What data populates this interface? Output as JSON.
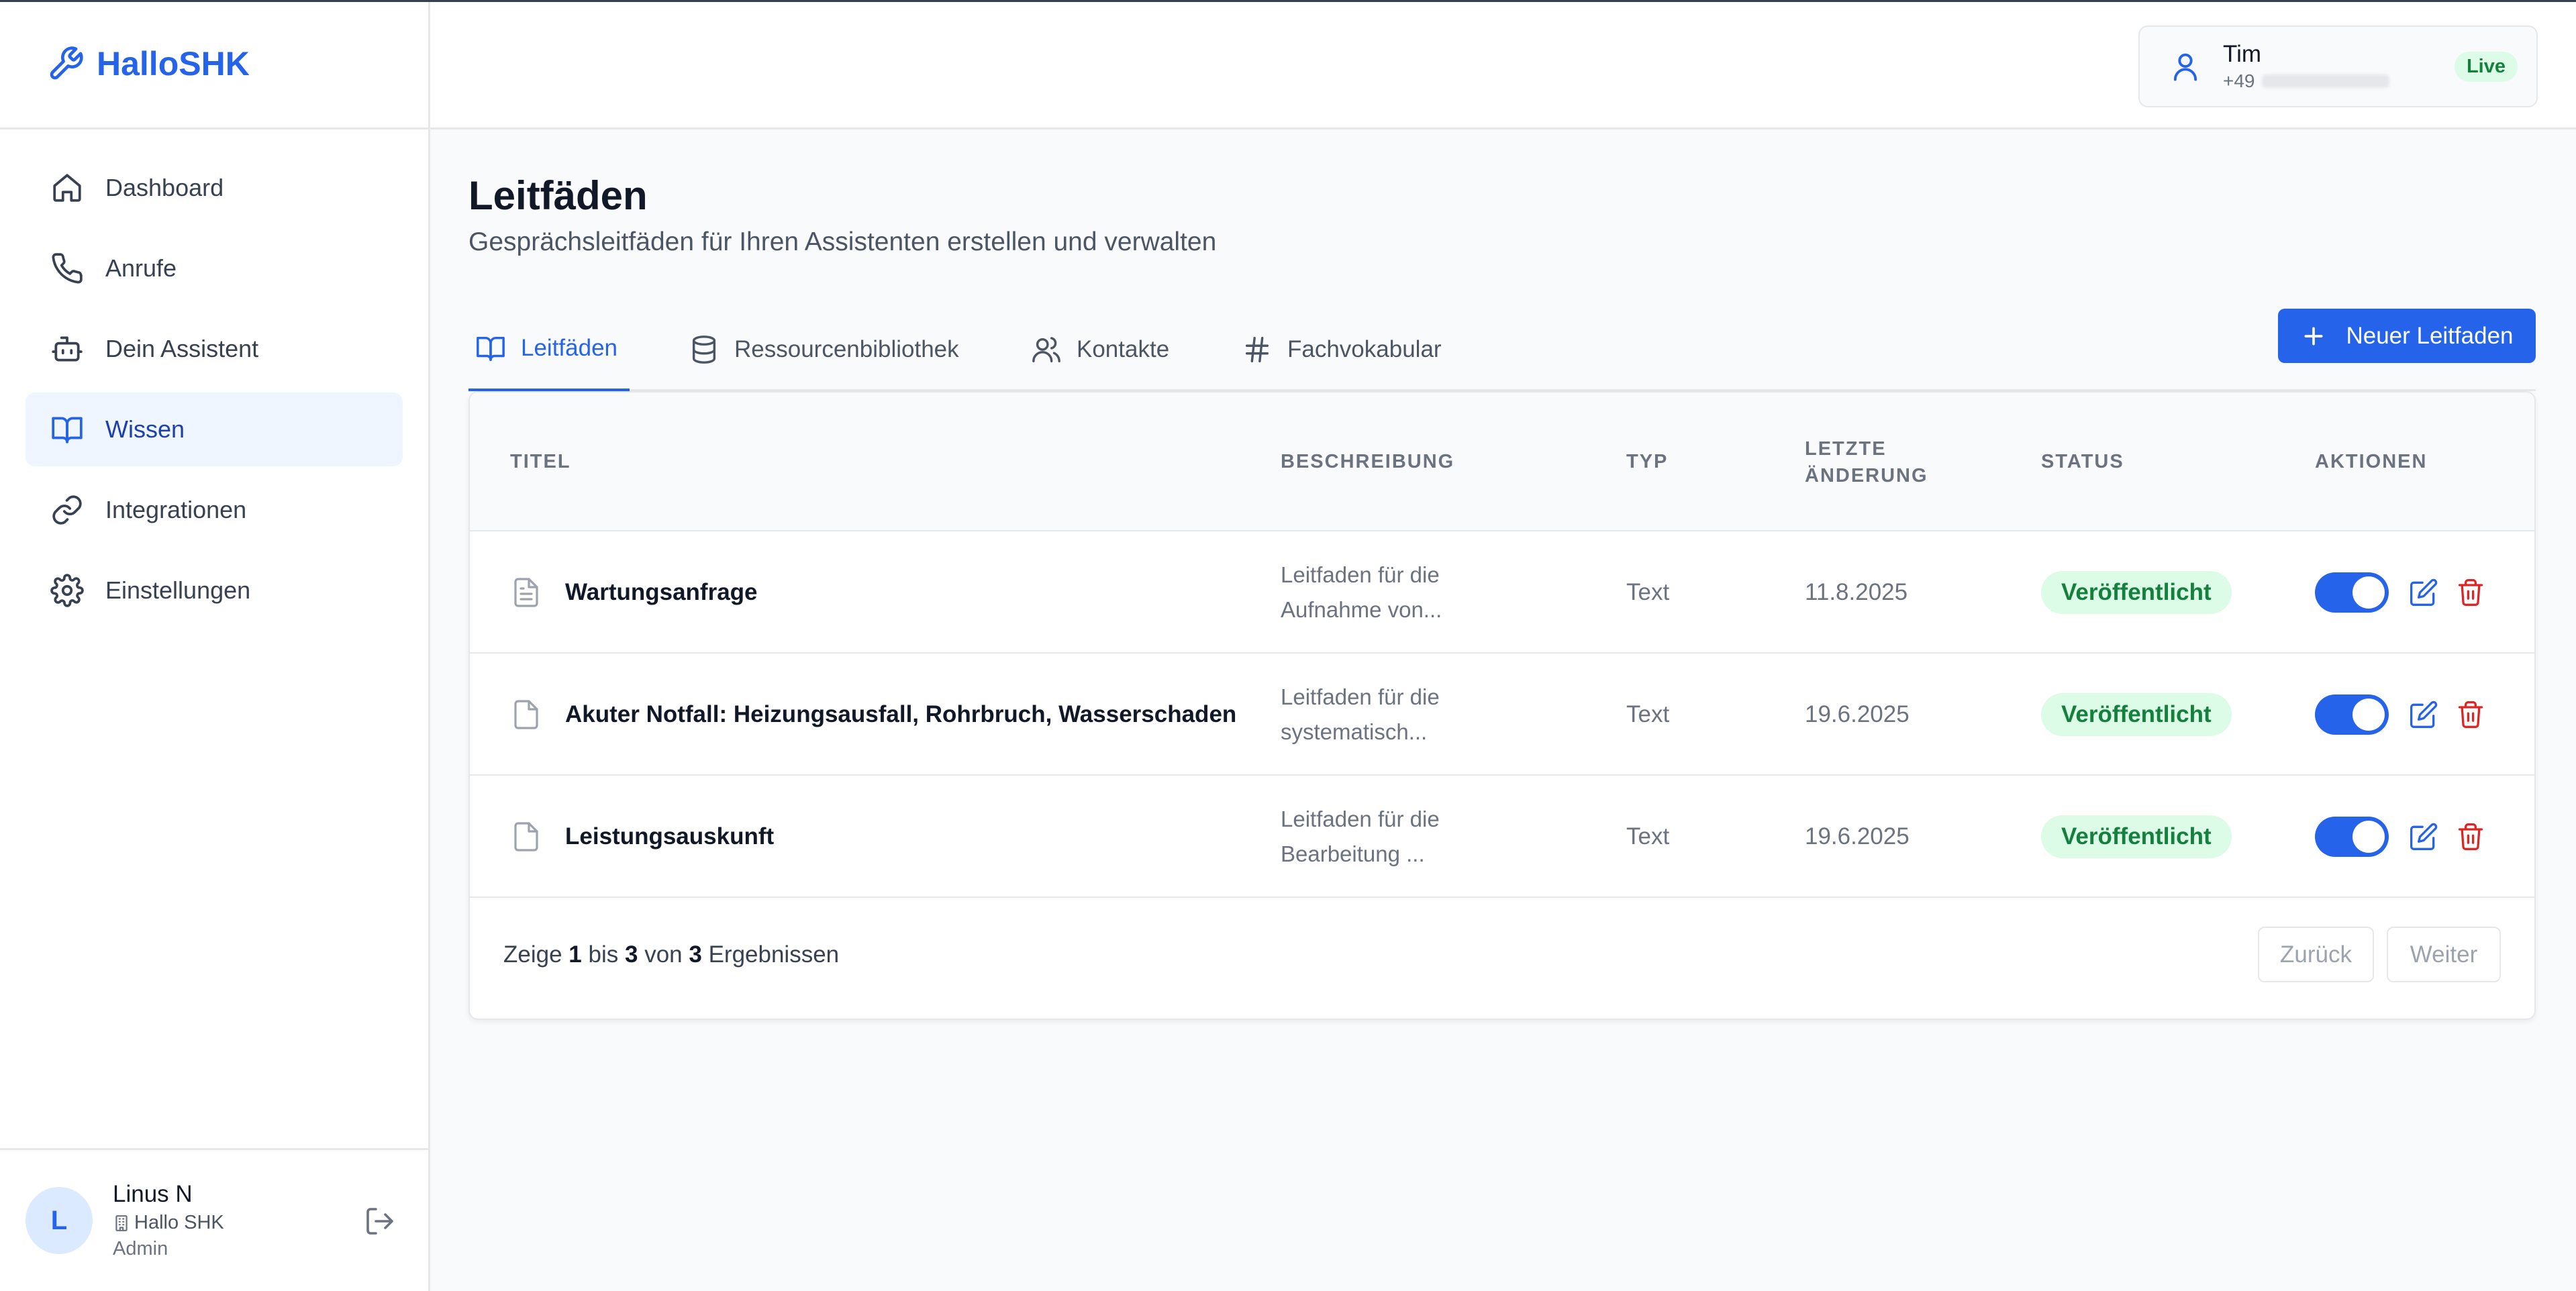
{
  "app": {
    "name": "HalloSHK"
  },
  "sidebar": {
    "items": [
      {
        "label": "Dashboard"
      },
      {
        "label": "Anrufe"
      },
      {
        "label": "Dein Assistent"
      },
      {
        "label": "Wissen"
      },
      {
        "label": "Integrationen"
      },
      {
        "label": "Einstellungen"
      }
    ],
    "active_item": "Wissen"
  },
  "user": {
    "initial": "L",
    "name": "Linus N",
    "company": "Hallo SHK",
    "role": "Admin"
  },
  "header": {
    "assistant_name": "Tim",
    "phone_prefix": "+49",
    "status": "Live"
  },
  "page": {
    "title": "Leitfäden",
    "subtitle": "Gesprächsleitfäden für Ihren Assistenten erstellen und verwalten"
  },
  "tabs": [
    {
      "label": "Leitfäden"
    },
    {
      "label": "Ressourcenbibliothek"
    },
    {
      "label": "Kontakte"
    },
    {
      "label": "Fachvokabular"
    }
  ],
  "new_button": "Neuer Leitfaden",
  "table": {
    "headers": {
      "title": "TITEL",
      "description": "BESCHREIBUNG",
      "type": "TYP",
      "changed_1": "LETZTE",
      "changed_2": "ÄNDERUNG",
      "status": "STATUS",
      "actions": "AKTIONEN"
    },
    "rows": [
      {
        "title": "Wartungsanfrage",
        "desc_1": "Leitfaden für die",
        "desc_2": "Aufnahme von...",
        "type": "Text",
        "date": "11.8.2025",
        "status": "Veröffentlicht",
        "enabled": true
      },
      {
        "title": "Akuter Notfall: Heizungsausfall, Rohrbruch, Wasserschaden",
        "desc_1": "Leitfaden für die",
        "desc_2": "systematisch...",
        "type": "Text",
        "date": "19.6.2025",
        "status": "Veröffentlicht",
        "enabled": true
      },
      {
        "title": "Leistungsauskunft",
        "desc_1": "Leitfaden für die",
        "desc_2": "Bearbeitung ...",
        "type": "Text",
        "date": "19.6.2025",
        "status": "Veröffentlicht",
        "enabled": true
      }
    ]
  },
  "pagination": {
    "prefix": "Zeige",
    "from": "1",
    "mid1": "bis",
    "to": "3",
    "mid2": "von",
    "total": "3",
    "suffix": "Ergebnissen",
    "prev": "Zurück",
    "next": "Weiter"
  },
  "colors": {
    "accent": "#2563eb",
    "success_bg": "#dcfce7",
    "success_text": "#15803d",
    "danger": "#dc2626"
  }
}
